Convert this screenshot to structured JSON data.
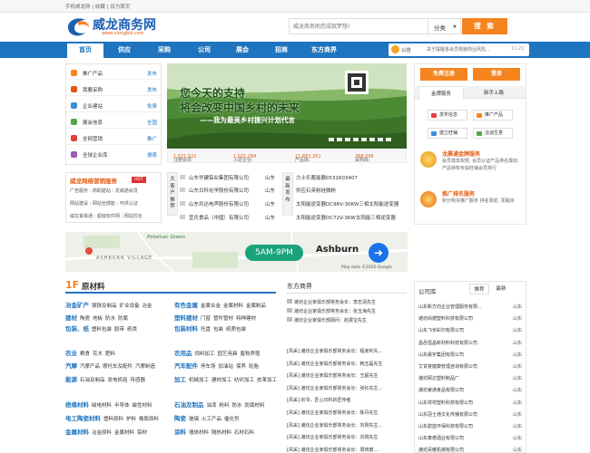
{
  "topbar": {
    "text": "手机威龙网 | 收藏 | 设为首页"
  },
  "logo": {
    "name": "威龙商务网",
    "url": "www.vlongbiz.com"
  },
  "search": {
    "placeholder": "威龙商务助您成就梦想!",
    "category": "分类",
    "button": "搜 索"
  },
  "nav": {
    "items": [
      "首页",
      "供应",
      "采购",
      "公司",
      "展会",
      "招商",
      "东方商界"
    ]
  },
  "notice": {
    "label": "公告",
    "text": "关于提醒各会员规避商业风险...",
    "date": "11-21"
  },
  "left_menu": [
    {
      "label": "推广产品",
      "action": "发布",
      "color": "#f5841f"
    },
    {
      "label": "我要采购",
      "action": "发布",
      "color": "#e25b12"
    },
    {
      "label": "企业建站",
      "action": "免费",
      "color": "#3a8fd6"
    },
    {
      "label": "展会信息",
      "action": "全国",
      "color": "#4fa84a"
    },
    {
      "label": "全网营销",
      "action": "推广",
      "color": "#e63c3c"
    },
    {
      "label": "全球企业库",
      "action": "搜索",
      "color": "#9b59b6"
    }
  ],
  "banner": {
    "line1": "您今天的支持",
    "line2": "将会改变中国乡村的未来",
    "line3": "——我为最美乡村振兴计划代言"
  },
  "stats": [
    {
      "label": "注册会员:",
      "value": "1,021,521"
    },
    {
      "label": "入驻企业:",
      "value": "1,021,284"
    },
    {
      "label": "产品库:",
      "value": "11,663,261"
    },
    {
      "label": "采购库:",
      "value": "268,096"
    }
  ],
  "login": {
    "free_register": "免费注册",
    "login": "登录",
    "tabs": [
      "金牌服务",
      "新手上路"
    ],
    "buttons": [
      {
        "label": "发布信息",
        "color": "#e63c3c"
      },
      {
        "label": "推广产品",
        "color": "#f5841f"
      },
      {
        "label": "建立旺铺",
        "color": "#3a8fd6"
      },
      {
        "label": "洽谈生意",
        "color": "#4fa84a"
      }
    ],
    "services": [
      {
        "title": "龙晨通金牌服务",
        "desc": "会员尊享权限, 会员认证产品排名靠前, 产品特权专属旺铺会员排行",
        "color": "#f5a623"
      },
      {
        "title": "推广排名服务",
        "desc": "积分购买推广服务 排名靠前, 更醒目",
        "color": "#e63c3c"
      }
    ]
  },
  "promo": {
    "title": "威龙网络营销服务",
    "hot": "HOT",
    "rows": [
      "广告服务 : 商助建站 : 龙威通会员",
      "网站建设 : 网站全部能 : 可供认证",
      "威龙掌易通 : 超级软件网 : 网站优化"
    ]
  },
  "recommend": {
    "label": "大客户推荐",
    "rows": [
      {
        "name": "山东华建铝业集团有限公司",
        "place": "山东"
      },
      {
        "name": "山东日科化学股份有限公司",
        "place": "山东"
      },
      {
        "name": "山东共达电声股份有限公司",
        "place": "山东"
      },
      {
        "name": "宜氏食品（中国）有限公司",
        "place": "山东"
      }
    ]
  },
  "latest": {
    "label": "最新发布",
    "rows": [
      "力士乐蓄能器0531603407",
      "供应石英粉硅微粉",
      "太阳能逆变器DC96V-30KW三相太阳能逆变器",
      "太阳能逆变器DC72V-3KW太阳能三相逆变器"
    ]
  },
  "map": {
    "place": "Potomac Green",
    "village": "ASHBURN VILLAGE",
    "hours": "5AM-9PM",
    "city": "Ashburn",
    "credit": "Map data ©2020 Google"
  },
  "floor1": {
    "num": "1F",
    "title": "原材料",
    "groups": [
      {
        "key": "冶金矿产",
        "subs": [
          "钢铁及制品",
          "矿业设备",
          "冶金"
        ]
      },
      {
        "key": "有色金属",
        "subs": [
          "金属合金",
          "金属材料",
          "金属制品"
        ]
      },
      {
        "key": "建材",
        "subs": [
          "陶瓷",
          "地板",
          "防水",
          "防腐"
        ]
      },
      {
        "key": "塑料建材",
        "subs": [
          "门窗",
          "管件管材",
          "特种建材"
        ]
      },
      {
        "key": "包装、纸",
        "subs": [
          "塑料包装",
          "胶带",
          "纸类"
        ]
      },
      {
        "key": "包装材料",
        "subs": [
          "托盘",
          "包装",
          "纸质包装"
        ]
      },
      {
        "key": "农业",
        "subs": [
          "粮食",
          "花木",
          "肥料"
        ]
      },
      {
        "key": "农用品",
        "subs": [
          "饲料加工",
          "园艺用具",
          "畜牧养殖"
        ]
      },
      {
        "key": "汽摩",
        "subs": [
          "汽摩产品",
          "摩托车及配件",
          "汽摩制造"
        ]
      },
      {
        "key": "汽车配件",
        "subs": [
          "停车场",
          "加油站",
          "保养",
          "轮胎"
        ]
      },
      {
        "key": "能源",
        "subs": [
          "石油及制品",
          "发电机组",
          "传感器"
        ]
      },
      {
        "key": "加工",
        "subs": [
          "机械加工",
          "建材加工",
          "纺织加工",
          "皮革加工"
        ]
      },
      {
        "key": "绝缘材料",
        "subs": [
          "磁电材料",
          "半导体",
          "磁性材料"
        ]
      },
      {
        "key": "石油及制品",
        "subs": [
          "油漆",
          "粉料",
          "防水",
          "防腐材料"
        ]
      },
      {
        "key": "电工陶瓷材料",
        "subs": [
          "塑料原料",
          "炉料",
          "橡胶原料"
        ]
      },
      {
        "key": "陶瓷",
        "subs": [
          "玻璃",
          "火工产品",
          "催化剂"
        ]
      },
      {
        "key": "金属材料",
        "subs": [
          "冶金原料",
          "金属材料",
          "铝材"
        ]
      },
      {
        "key": "涂料",
        "subs": [
          "墙体材料",
          "隔热材料",
          "石材石料"
        ]
      }
    ]
  },
  "east": {
    "title": "东方商界",
    "photo_rows": [
      "潍坊企业家俱乐部常务会长：李志清先生",
      "潍坊企业家俱乐部常务会长：张玉海先生",
      "潍坊企业家俱乐部顾问：赵振宝先生"
    ],
    "rows": [
      "[风采] 潍坊企业家俱乐部常务会长：程家利先...",
      "[风采] 潍坊企业家俱乐部常务会长：韩玉磊先生",
      "[风采] 潍坊企业家俱乐部常务会长：王超先生",
      "[风采] 潍坊企业家俱乐部常务会长：张红先生...",
      "[风采] 初寻，匠心日料的匠传者",
      "[风采] 潍坊企业家俱乐部常务会长：陈丹先生",
      "[风采] 潍坊企业家俱乐部常务会长：刘刚先生...",
      "[风采] 潍坊企业家俱乐部常务会长：刘刚先生",
      "[风采] 潍坊企业家俱乐部常务会长：周晓丽..."
    ]
  },
  "companies": {
    "title": "公司库",
    "tabs": [
      "推荐",
      "最新"
    ],
    "rows": [
      {
        "name": "山东新方向企业管理服务有限...",
        "region": "山东"
      },
      {
        "name": "潍坊尚德塑料科技有限公司",
        "region": "山东"
      },
      {
        "name": "山东飞米彩印有限公司",
        "region": "山东"
      },
      {
        "name": "昌邑恒昌新材料科技有限公司",
        "region": "山东"
      },
      {
        "name": "山东晨宇集团有限公司",
        "region": "山东"
      },
      {
        "name": "艾甘斐健康管理咨询有限公司",
        "region": "山东"
      },
      {
        "name": "潍坊颐达塑料制品厂",
        "region": "山东"
      },
      {
        "name": "潍坊睿通食品有限公司",
        "region": "山东"
      },
      {
        "name": "山东祥祥塑料科技有限公司",
        "region": "山东"
      },
      {
        "name": "山东冠士通文化传播有限公司",
        "region": "山东"
      },
      {
        "name": "山东碧蓝环保科技有限公司",
        "region": "山东"
      },
      {
        "name": "山东泰德酒业有限公司",
        "region": "山东"
      },
      {
        "name": "潍坊百耀机械有限公司",
        "region": "山东"
      }
    ]
  }
}
